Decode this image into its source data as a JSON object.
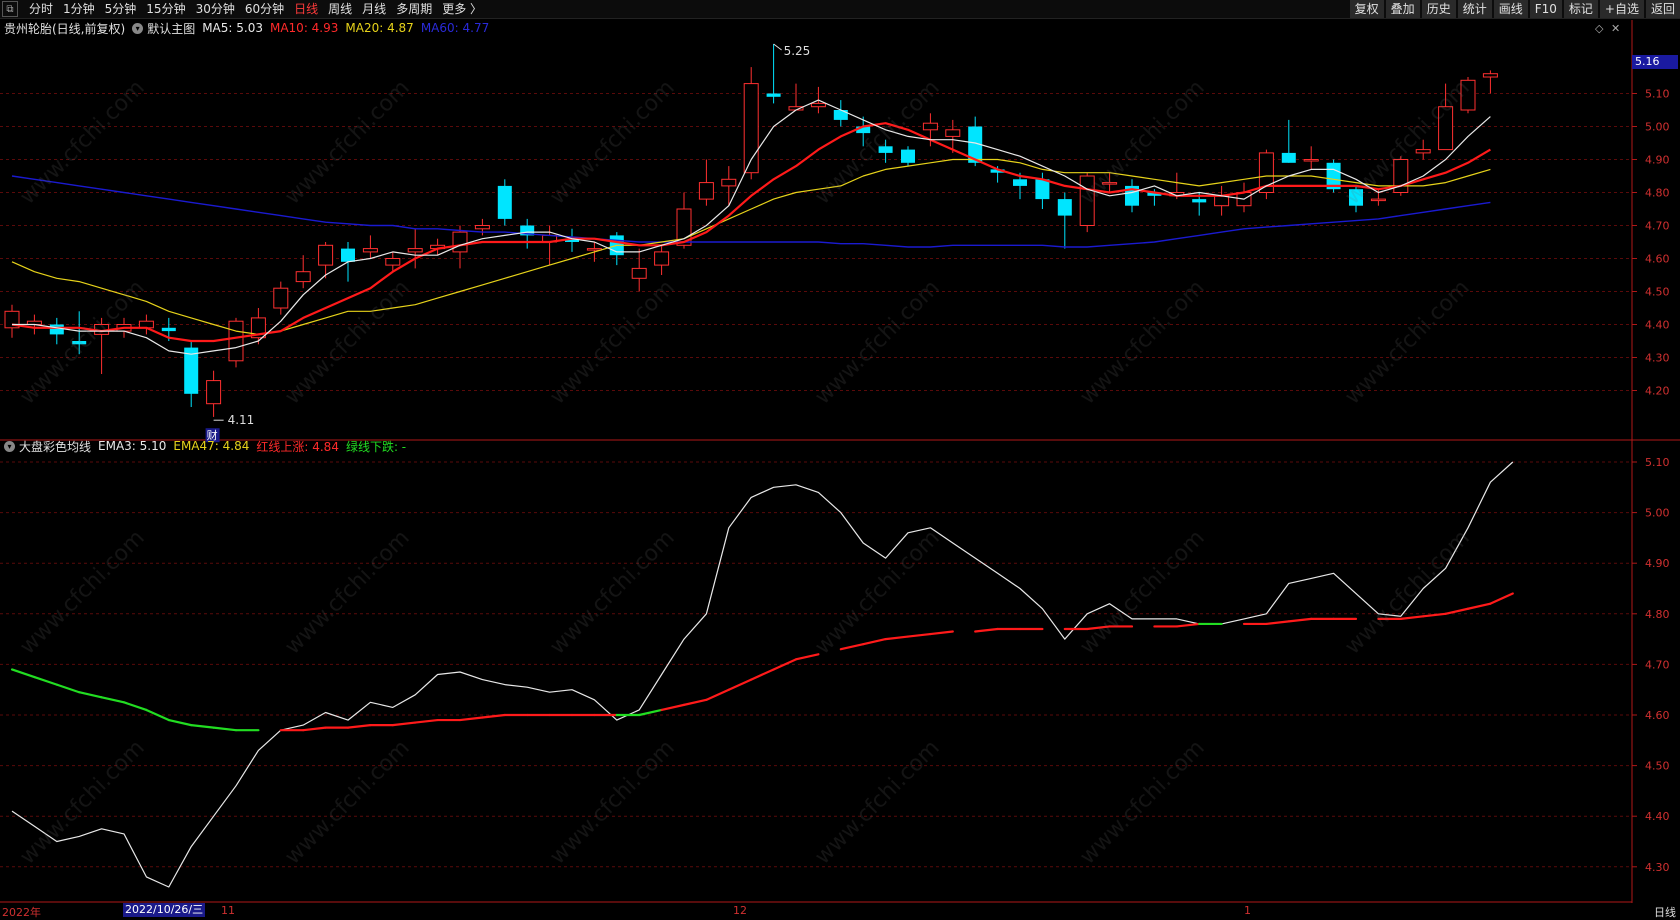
{
  "topbar": {
    "left_items": [
      "分时",
      "1分钟",
      "5分钟",
      "15分钟",
      "30分钟",
      "60分钟",
      "日线",
      "周线",
      "月线",
      "多周期",
      "更多 〉"
    ],
    "active": "日线",
    "right_items": [
      "复权",
      "叠加",
      "历史",
      "统计",
      "画线",
      "F10",
      "标记",
      "+自选",
      "返回"
    ]
  },
  "main_legend": {
    "stock": "贵州轮胎(日线,前复权)",
    "template": "默认主图",
    "ma5": "MA5: 5.03",
    "ma10": "MA10: 4.93",
    "ma20": "MA20: 4.87",
    "ma60": "MA60: 4.77"
  },
  "sub_legend": {
    "name": "大盘彩色均线",
    "ema3": "EMA3: 5.10",
    "ema47": "EMA47: 4.84",
    "red": "红线上涨: 4.84",
    "green": "绿线下跌: -"
  },
  "price_tag": "5.16",
  "annotations": {
    "high": "5.25",
    "low": "4.11",
    "cai": "财"
  },
  "main_scale": [
    "5.10",
    "5.00",
    "4.90",
    "4.80",
    "4.70",
    "4.60",
    "4.50",
    "4.40",
    "4.30",
    "4.20"
  ],
  "sub_scale": [
    "5.10",
    "5.00",
    "4.90",
    "4.80",
    "4.70",
    "4.60",
    "4.50",
    "4.40",
    "4.30"
  ],
  "bottom": {
    "year": "2022年",
    "selected_date": "2022/10/26/三",
    "m11": "11",
    "m12": "12",
    "m1": "1",
    "period": "日线"
  },
  "watermark": "www.cfchi.com",
  "colors": {
    "up": "#ff3030",
    "down": "#00e5ff",
    "ma5": "#e8e8e8",
    "ma10": "#ff1a1a",
    "ma20": "#e6d21a",
    "ma60": "#1a1ad0",
    "grid": "#5a0a0a"
  },
  "chart_data": [
    {
      "type": "candlestick",
      "title": "贵州轮胎(日线,前复权)",
      "ylim": [
        4.13,
        5.25
      ],
      "candles": [
        [
          4.39,
          4.44,
          4.46,
          4.36
        ],
        [
          4.4,
          4.41,
          4.43,
          4.37
        ],
        [
          4.4,
          4.37,
          4.42,
          4.34
        ],
        [
          4.35,
          4.34,
          4.44,
          4.31
        ],
        [
          4.37,
          4.4,
          4.42,
          4.25
        ],
        [
          4.38,
          4.4,
          4.42,
          4.36
        ],
        [
          4.39,
          4.41,
          4.43,
          4.37
        ],
        [
          4.39,
          4.38,
          4.42,
          4.35
        ],
        [
          4.33,
          4.19,
          4.35,
          4.15
        ],
        [
          4.16,
          4.23,
          4.26,
          4.12
        ],
        [
          4.29,
          4.41,
          4.42,
          4.27
        ],
        [
          4.36,
          4.42,
          4.45,
          4.34
        ],
        [
          4.45,
          4.51,
          4.53,
          4.43
        ],
        [
          4.53,
          4.56,
          4.61,
          4.51
        ],
        [
          4.58,
          4.64,
          4.65,
          4.54
        ],
        [
          4.63,
          4.59,
          4.65,
          4.53
        ],
        [
          4.62,
          4.63,
          4.67,
          4.6
        ],
        [
          4.58,
          4.6,
          4.62,
          4.56
        ],
        [
          4.62,
          4.63,
          4.69,
          4.57
        ],
        [
          4.63,
          4.64,
          4.66,
          4.61
        ],
        [
          4.62,
          4.68,
          4.7,
          4.57
        ],
        [
          4.69,
          4.7,
          4.72,
          4.67
        ],
        [
          4.82,
          4.72,
          4.84,
          4.7
        ],
        [
          4.7,
          4.67,
          4.72,
          4.63
        ],
        [
          4.65,
          4.67,
          4.7,
          4.58
        ],
        [
          4.66,
          4.65,
          4.69,
          4.62
        ],
        [
          4.63,
          4.63,
          4.65,
          4.59
        ],
        [
          4.67,
          4.61,
          4.68,
          4.58
        ],
        [
          4.54,
          4.57,
          4.63,
          4.5
        ],
        [
          4.58,
          4.62,
          4.64,
          4.55
        ],
        [
          4.64,
          4.75,
          4.8,
          4.63
        ],
        [
          4.78,
          4.83,
          4.9,
          4.76
        ],
        [
          4.82,
          4.84,
          4.88,
          4.76
        ],
        [
          4.86,
          5.13,
          5.18,
          4.84
        ],
        [
          5.1,
          5.09,
          5.25,
          5.07
        ],
        [
          5.05,
          5.06,
          5.13,
          5.05
        ],
        [
          5.06,
          5.07,
          5.12,
          5.04
        ],
        [
          5.05,
          5.02,
          5.08,
          5.0
        ],
        [
          5.0,
          4.98,
          5.03,
          4.94
        ],
        [
          4.94,
          4.92,
          4.96,
          4.89
        ],
        [
          4.93,
          4.89,
          4.94,
          4.88
        ],
        [
          4.99,
          5.01,
          5.04,
          4.94
        ],
        [
          4.97,
          4.99,
          5.02,
          4.92
        ],
        [
          5.0,
          4.89,
          5.03,
          4.88
        ],
        [
          4.87,
          4.86,
          4.88,
          4.83
        ],
        [
          4.84,
          4.82,
          4.86,
          4.78
        ],
        [
          4.84,
          4.78,
          4.86,
          4.75
        ],
        [
          4.78,
          4.73,
          4.8,
          4.63
        ],
        [
          4.7,
          4.85,
          4.86,
          4.68
        ],
        [
          4.83,
          4.83,
          4.86,
          4.8
        ],
        [
          4.82,
          4.76,
          4.84,
          4.74
        ],
        [
          4.8,
          4.79,
          4.81,
          4.76
        ],
        [
          4.79,
          4.8,
          4.86,
          4.78
        ],
        [
          4.78,
          4.77,
          4.8,
          4.73
        ],
        [
          4.76,
          4.79,
          4.82,
          4.73
        ],
        [
          4.76,
          4.8,
          4.83,
          4.74
        ],
        [
          4.8,
          4.92,
          4.93,
          4.78
        ],
        [
          4.92,
          4.89,
          5.02,
          4.89
        ],
        [
          4.9,
          4.9,
          4.94,
          4.87
        ],
        [
          4.89,
          4.81,
          4.9,
          4.8
        ],
        [
          4.81,
          4.76,
          4.82,
          4.74
        ],
        [
          4.78,
          4.78,
          4.81,
          4.76
        ],
        [
          4.8,
          4.9,
          4.91,
          4.79
        ],
        [
          4.92,
          4.93,
          4.96,
          4.9
        ],
        [
          4.93,
          5.06,
          5.13,
          5.03
        ],
        [
          5.05,
          5.14,
          5.15,
          5.04
        ],
        [
          5.15,
          5.16,
          5.17,
          5.1
        ]
      ],
      "ma5": [
        4.4,
        4.4,
        4.39,
        4.38,
        4.38,
        4.38,
        4.36,
        4.32,
        4.31,
        4.32,
        4.33,
        4.35,
        4.41,
        4.49,
        4.55,
        4.59,
        4.6,
        4.62,
        4.61,
        4.61,
        4.64,
        4.66,
        4.67,
        4.68,
        4.68,
        4.66,
        4.65,
        4.62,
        4.62,
        4.64,
        4.66,
        4.7,
        4.76,
        4.9,
        5.0,
        5.05,
        5.08,
        5.05,
        5.02,
        4.99,
        4.97,
        4.96,
        4.96,
        4.95,
        4.93,
        4.91,
        4.88,
        4.85,
        4.81,
        4.79,
        4.8,
        4.82,
        4.79,
        4.8,
        4.79,
        4.78,
        4.82,
        4.85,
        4.87,
        4.87,
        4.84,
        4.8,
        4.82,
        4.85,
        4.9,
        4.97,
        5.03
      ],
      "ma10": [
        4.4,
        4.39,
        4.39,
        4.39,
        4.38,
        4.39,
        4.39,
        4.36,
        4.35,
        4.35,
        4.36,
        4.37,
        4.38,
        4.42,
        4.45,
        4.48,
        4.51,
        4.56,
        4.6,
        4.63,
        4.64,
        4.65,
        4.65,
        4.65,
        4.65,
        4.66,
        4.66,
        4.65,
        4.64,
        4.64,
        4.65,
        4.68,
        4.73,
        4.79,
        4.84,
        4.88,
        4.93,
        4.97,
        5.0,
        5.01,
        4.99,
        4.96,
        4.93,
        4.9,
        4.87,
        4.85,
        4.84,
        4.82,
        4.81,
        4.8,
        4.81,
        4.8,
        4.79,
        4.79,
        4.79,
        4.8,
        4.82,
        4.82,
        4.82,
        4.82,
        4.82,
        4.81,
        4.82,
        4.84,
        4.86,
        4.89,
        4.93
      ],
      "ma20": [
        4.59,
        4.56,
        4.54,
        4.53,
        4.51,
        4.49,
        4.47,
        4.44,
        4.42,
        4.4,
        4.38,
        4.37,
        4.38,
        4.4,
        4.42,
        4.44,
        4.44,
        4.45,
        4.46,
        4.48,
        4.5,
        4.52,
        4.54,
        4.56,
        4.58,
        4.6,
        4.62,
        4.64,
        4.64,
        4.65,
        4.66,
        4.69,
        4.72,
        4.75,
        4.78,
        4.8,
        4.81,
        4.82,
        4.85,
        4.87,
        4.88,
        4.89,
        4.9,
        4.9,
        4.9,
        4.89,
        4.87,
        4.86,
        4.86,
        4.86,
        4.85,
        4.84,
        4.83,
        4.82,
        4.83,
        4.84,
        4.85,
        4.85,
        4.85,
        4.84,
        4.83,
        4.82,
        4.82,
        4.82,
        4.83,
        4.85,
        4.87
      ],
      "ma60": [
        4.85,
        4.84,
        4.83,
        4.82,
        4.81,
        4.8,
        4.79,
        4.78,
        4.77,
        4.76,
        4.75,
        4.74,
        4.73,
        4.72,
        4.71,
        4.705,
        4.7,
        4.7,
        4.69,
        4.69,
        4.685,
        4.68,
        4.68,
        4.675,
        4.67,
        4.665,
        4.66,
        4.655,
        4.65,
        4.65,
        4.65,
        4.65,
        4.65,
        4.65,
        4.65,
        4.65,
        4.65,
        4.645,
        4.645,
        4.64,
        4.635,
        4.635,
        4.64,
        4.64,
        4.64,
        4.64,
        4.64,
        4.635,
        4.635,
        4.64,
        4.645,
        4.65,
        4.66,
        4.67,
        4.68,
        4.69,
        4.695,
        4.7,
        4.705,
        4.71,
        4.715,
        4.72,
        4.73,
        4.74,
        4.75,
        4.76,
        4.77
      ]
    },
    {
      "type": "line",
      "title": "大盘彩色均线",
      "ylim": [
        4.27,
        5.12
      ],
      "ema3": [
        4.41,
        4.38,
        4.35,
        4.36,
        4.375,
        4.365,
        4.28,
        4.26,
        4.34,
        4.4,
        4.46,
        4.53,
        4.57,
        4.58,
        4.605,
        4.59,
        4.625,
        4.615,
        4.64,
        4.68,
        4.685,
        4.67,
        4.66,
        4.655,
        4.645,
        4.65,
        4.63,
        4.59,
        4.61,
        4.68,
        4.75,
        4.8,
        4.97,
        5.03,
        5.05,
        5.055,
        5.04,
        5.0,
        4.94,
        4.91,
        4.96,
        4.97,
        4.94,
        4.91,
        4.88,
        4.85,
        4.81,
        4.75,
        4.8,
        4.82,
        4.79,
        4.79,
        4.79,
        4.78,
        4.78,
        4.79,
        4.8,
        4.86,
        4.87,
        4.88,
        4.84,
        4.8,
        4.795,
        4.85,
        4.89,
        4.97,
        5.06,
        5.1
      ],
      "ema47": [
        4.69,
        4.675,
        4.66,
        4.645,
        4.635,
        4.625,
        4.61,
        4.59,
        4.58,
        4.575,
        4.57,
        4.57,
        4.57,
        4.57,
        4.575,
        4.575,
        4.58,
        4.58,
        4.585,
        4.59,
        4.59,
        4.595,
        4.6,
        4.6,
        4.6,
        4.6,
        4.6,
        4.6,
        4.6,
        4.61,
        4.62,
        4.63,
        4.65,
        4.67,
        4.69,
        4.71,
        4.72,
        4.73,
        4.74,
        4.75,
        4.755,
        4.76,
        4.765,
        4.765,
        4.77,
        4.77,
        4.77,
        4.77,
        4.77,
        4.775,
        4.775,
        4.775,
        4.775,
        4.78,
        4.78,
        4.78,
        4.78,
        4.785,
        4.79,
        4.79,
        4.79,
        4.79,
        4.79,
        4.795,
        4.8,
        4.81,
        4.82,
        4.84
      ],
      "green_indices": [
        0,
        1,
        2,
        3,
        4,
        5,
        6,
        7,
        8,
        9,
        10,
        27,
        28,
        53
      ],
      "gap_indices": [
        11,
        36,
        42,
        46,
        50,
        54,
        60
      ]
    }
  ]
}
